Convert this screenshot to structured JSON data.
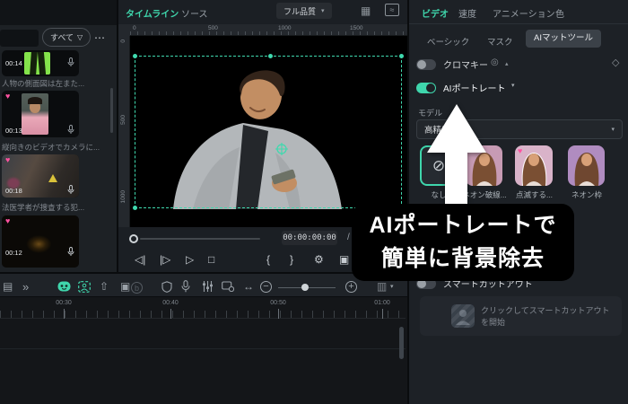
{
  "colors": {
    "accent": "#3fd6ac",
    "favorite": "#ff52a1",
    "greenscreen": "#84e34b",
    "callout_bg": "#000000",
    "arrow": "#ffffff"
  },
  "icons": {
    "more": "⋯",
    "funnel": "▽",
    "caret_down": "▾",
    "caret_up": "▴",
    "grid": "▦",
    "waveform": "≈",
    "prev_frame": "◁|",
    "step_frame": "|▷",
    "play": "▷",
    "stop": "□",
    "mark_in": "{",
    "mark_out": "}",
    "settings": "⚙",
    "camera": "▣",
    "keyframe": "◇",
    "circle_badge": "◎",
    "none": "⊘",
    "collapse": "»",
    "select_tool": "▤",
    "export": "⇧",
    "media_pip": "▣",
    "speed_b": "b",
    "fit": "↔",
    "zoom_out": "−",
    "zoom_in": "+",
    "track_list": "▥",
    "heart": "♥"
  },
  "media_panel": {
    "filter_button": "すべて",
    "items": [
      {
        "duration": "00:14",
        "caption": "人物の側面図は左また...",
        "favorite": false
      },
      {
        "duration": "00:13",
        "caption": "縦向きのビデオでカメラに...",
        "favorite": true
      },
      {
        "duration": "00:18",
        "caption": "法医学者が捜査する犯...",
        "favorite": true
      },
      {
        "duration": "00:12",
        "caption": "",
        "favorite": true
      }
    ]
  },
  "preview": {
    "tabs": {
      "timeline": "タイムライン",
      "source": "ソース"
    },
    "quality_selector": "フル品質",
    "ruler_top": [
      "0",
      "500",
      "1000",
      "1500"
    ],
    "ruler_left": [
      "0",
      "500",
      "1000"
    ],
    "timecode": "00:00:00:00",
    "separator": "/"
  },
  "timeline": {
    "ticks": [
      "00:30",
      "00:40",
      "00:50",
      "01:00"
    ]
  },
  "properties": {
    "tabs": {
      "video": "ビデオ",
      "speed": "速度",
      "animation": "アニメーション",
      "color": "色"
    },
    "subtabs": {
      "basic": "ベーシック",
      "mask": "マスク",
      "ai_mat": "AIマットツール"
    },
    "chroma_key": {
      "label": "クロマキー"
    },
    "ai_portrait": {
      "label": "AIポートレート"
    },
    "model": {
      "label": "モデル",
      "value": "高精度"
    },
    "effects": [
      {
        "label": "なし"
      },
      {
        "label": "ネオン破線..."
      },
      {
        "label": "点滅する..."
      },
      {
        "label": "ネオン枠"
      }
    ],
    "smart_cutout": {
      "label": "スマートカットアウト",
      "button": "クリックしてスマートカットアウトを開始"
    }
  },
  "callout": {
    "line1": "AIポートレートで",
    "line2": "簡単に背景除去"
  }
}
